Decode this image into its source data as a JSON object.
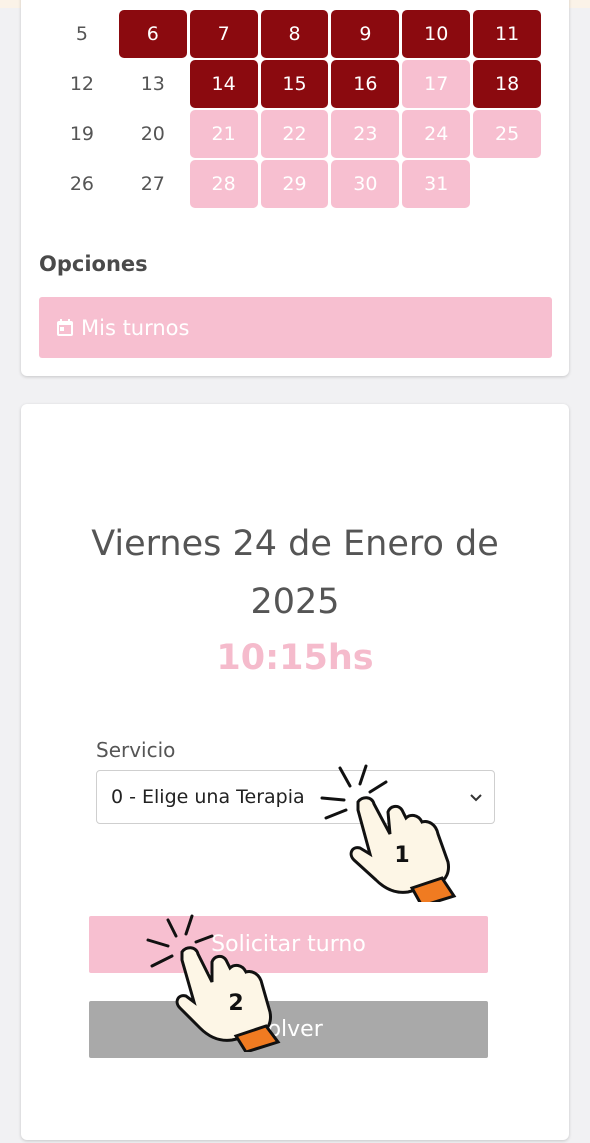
{
  "calendar": {
    "rows": [
      [
        {
          "d": "5",
          "s": "plain"
        },
        {
          "d": "6",
          "s": "booked"
        },
        {
          "d": "7",
          "s": "booked"
        },
        {
          "d": "8",
          "s": "booked"
        },
        {
          "d": "9",
          "s": "booked"
        },
        {
          "d": "10",
          "s": "booked"
        },
        {
          "d": "11",
          "s": "booked"
        }
      ],
      [
        {
          "d": "12",
          "s": "plain"
        },
        {
          "d": "13",
          "s": "plain"
        },
        {
          "d": "14",
          "s": "booked"
        },
        {
          "d": "15",
          "s": "booked"
        },
        {
          "d": "16",
          "s": "booked"
        },
        {
          "d": "17",
          "s": "avail"
        },
        {
          "d": "18",
          "s": "booked"
        }
      ],
      [
        {
          "d": "19",
          "s": "plain"
        },
        {
          "d": "20",
          "s": "plain"
        },
        {
          "d": "21",
          "s": "avail"
        },
        {
          "d": "22",
          "s": "avail"
        },
        {
          "d": "23",
          "s": "avail"
        },
        {
          "d": "24",
          "s": "avail"
        },
        {
          "d": "25",
          "s": "avail"
        }
      ],
      [
        {
          "d": "26",
          "s": "plain"
        },
        {
          "d": "27",
          "s": "plain"
        },
        {
          "d": "28",
          "s": "avail"
        },
        {
          "d": "29",
          "s": "avail"
        },
        {
          "d": "30",
          "s": "avail"
        },
        {
          "d": "31",
          "s": "avail"
        },
        {
          "d": "",
          "s": "empty"
        }
      ]
    ]
  },
  "options": {
    "title": "Opciones",
    "mis_turnos_label": "Mis turnos",
    "mis_turnos_icon": "calendar-icon"
  },
  "booking": {
    "date_line1": "Viernes 24 de Enero de",
    "date_line2": "2025",
    "time": "10:15hs",
    "servicio_label": "Servicio",
    "servicio_value": "0 - Elige una Terapia",
    "solicitar_label": "Solicitar turno",
    "volver_label": "Volver"
  },
  "annotations": {
    "hand1_number": "1",
    "hand2_number": "2"
  },
  "colors": {
    "booked": "#8b0a0f",
    "available": "#f7bfd0",
    "accent_pink": "#f5bbcc",
    "volver_gray": "#a9a9a9"
  }
}
